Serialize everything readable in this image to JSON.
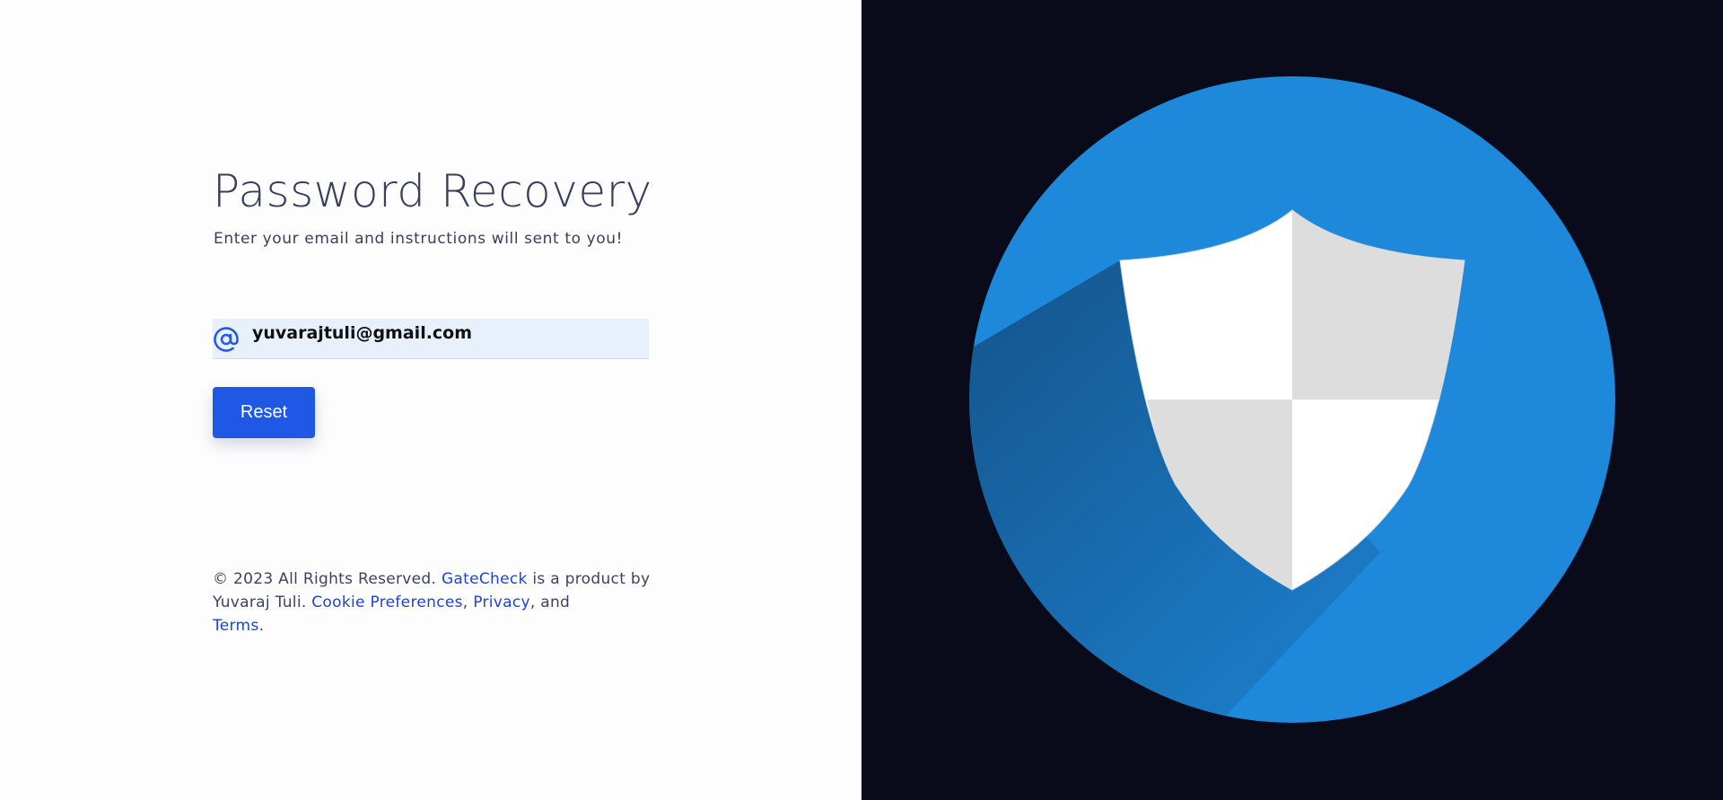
{
  "form": {
    "title": "Password Recovery",
    "subtitle": "Enter your email and instructions will sent to you!",
    "email_value": "yuvarajtuli@gmail.com",
    "email_icon": "at-sign-icon",
    "reset_label": "Reset"
  },
  "footer": {
    "copyright": "© 2023 All Rights Reserved.",
    "brand_link": "GateCheck",
    "product_text": "is a product by Yuvaraj Tuli.",
    "cookie_link": "Cookie Preferences",
    "privacy_link": "Privacy",
    "and_text": ", and",
    "terms_link": "Terms",
    "period": "."
  },
  "illustration": {
    "icon": "shield-icon",
    "background_color": "#090b1a",
    "circle_color": "#1e89db",
    "shield_light": "#ffffff",
    "shield_shade": "#dddddd"
  },
  "colors": {
    "accent": "#1f58e5",
    "link": "#1c45d0",
    "text": "#383e5e",
    "input_bg": "#e8f0fc"
  }
}
